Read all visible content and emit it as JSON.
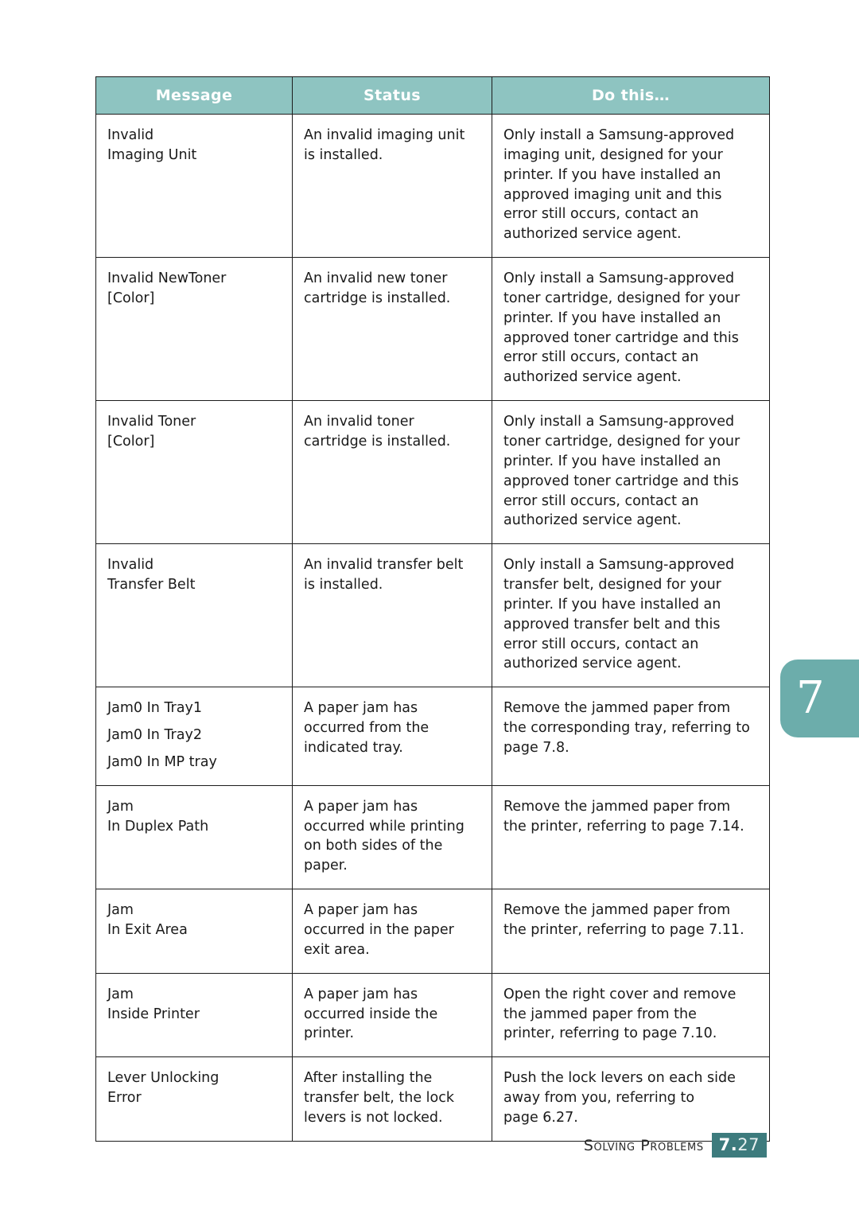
{
  "page": {
    "tab_marker": "7",
    "footer_title": "Solving Problems",
    "footer_page_major": "7.",
    "footer_page_minor": "27",
    "accent_teal_header": "#8ec4c1",
    "accent_teal_tab": "#6cadab",
    "accent_teal_footer": "#3d7b7d",
    "border_color": "#1c1c1c"
  },
  "table": {
    "headers": {
      "message": "Message",
      "status": "Status",
      "do_this": "Do this…"
    },
    "rows": [
      {
        "message": [
          "Invalid",
          "Imaging Unit"
        ],
        "status": [
          "An invalid imaging unit",
          "is installed."
        ],
        "do_this": [
          "Only install a Samsung-approved",
          "imaging unit, designed for your",
          "printer. If you have installed an",
          "approved imaging unit and this",
          "error still occurs, contact an",
          "authorized service agent."
        ]
      },
      {
        "message": [
          "Invalid NewToner",
          "[Color]"
        ],
        "status": [
          "An invalid new toner",
          "cartridge is installed."
        ],
        "do_this": [
          "Only install a Samsung-approved",
          "toner cartridge, designed for your",
          "printer. If you have installed an",
          "approved toner cartridge and this",
          "error still occurs, contact an",
          "authorized service agent."
        ]
      },
      {
        "message": [
          "Invalid Toner",
          "[Color]"
        ],
        "status": [
          "An invalid toner",
          "cartridge is installed."
        ],
        "do_this": [
          "Only install a Samsung-approved",
          "toner cartridge, designed for your",
          "printer. If you have installed an",
          "approved toner cartridge and this",
          "error still occurs, contact an",
          "authorized service agent."
        ]
      },
      {
        "message": [
          "Invalid",
          "Transfer Belt"
        ],
        "status": [
          "An invalid transfer belt",
          "is installed."
        ],
        "do_this": [
          "Only install a Samsung-approved",
          "transfer belt, designed for your",
          "printer. If you have installed an",
          "approved transfer belt and this",
          "error still occurs, contact an",
          "authorized service agent."
        ]
      },
      {
        "message": [
          "Jam0 In Tray1",
          "Jam0 In Tray2",
          "Jam0 In MP tray"
        ],
        "message_spaced": true,
        "status": [
          "A paper jam has",
          "occurred from the",
          "indicated tray."
        ],
        "do_this": [
          "Remove the jammed paper from",
          "the corresponding tray, referring to",
          "page 7.8."
        ]
      },
      {
        "message": [
          "Jam",
          "In Duplex Path"
        ],
        "status": [
          "A paper jam has",
          "occurred while printing",
          "on both sides of the",
          "paper."
        ],
        "do_this": [
          "Remove the jammed paper from",
          "the printer, referring to page 7.14."
        ]
      },
      {
        "message": [
          "Jam",
          "In Exit Area"
        ],
        "status": [
          "A paper jam has",
          "occurred in the paper",
          "exit area."
        ],
        "do_this": [
          "Remove the jammed paper from",
          "the printer, referring to page 7.11."
        ]
      },
      {
        "message": [
          "Jam",
          "Inside Printer"
        ],
        "status": [
          "A paper jam has",
          "occurred inside the",
          "printer."
        ],
        "do_this": [
          "Open the right cover and remove",
          "the jammed paper from the",
          "printer, referring to page 7.10."
        ]
      },
      {
        "message": [
          "Lever Unlocking",
          "Error"
        ],
        "status": [
          "After installing the",
          "transfer belt, the lock",
          "levers is not locked."
        ],
        "do_this": [
          "Push the lock levers on each side",
          "away from you, referring to",
          "page 6.27."
        ]
      }
    ]
  }
}
